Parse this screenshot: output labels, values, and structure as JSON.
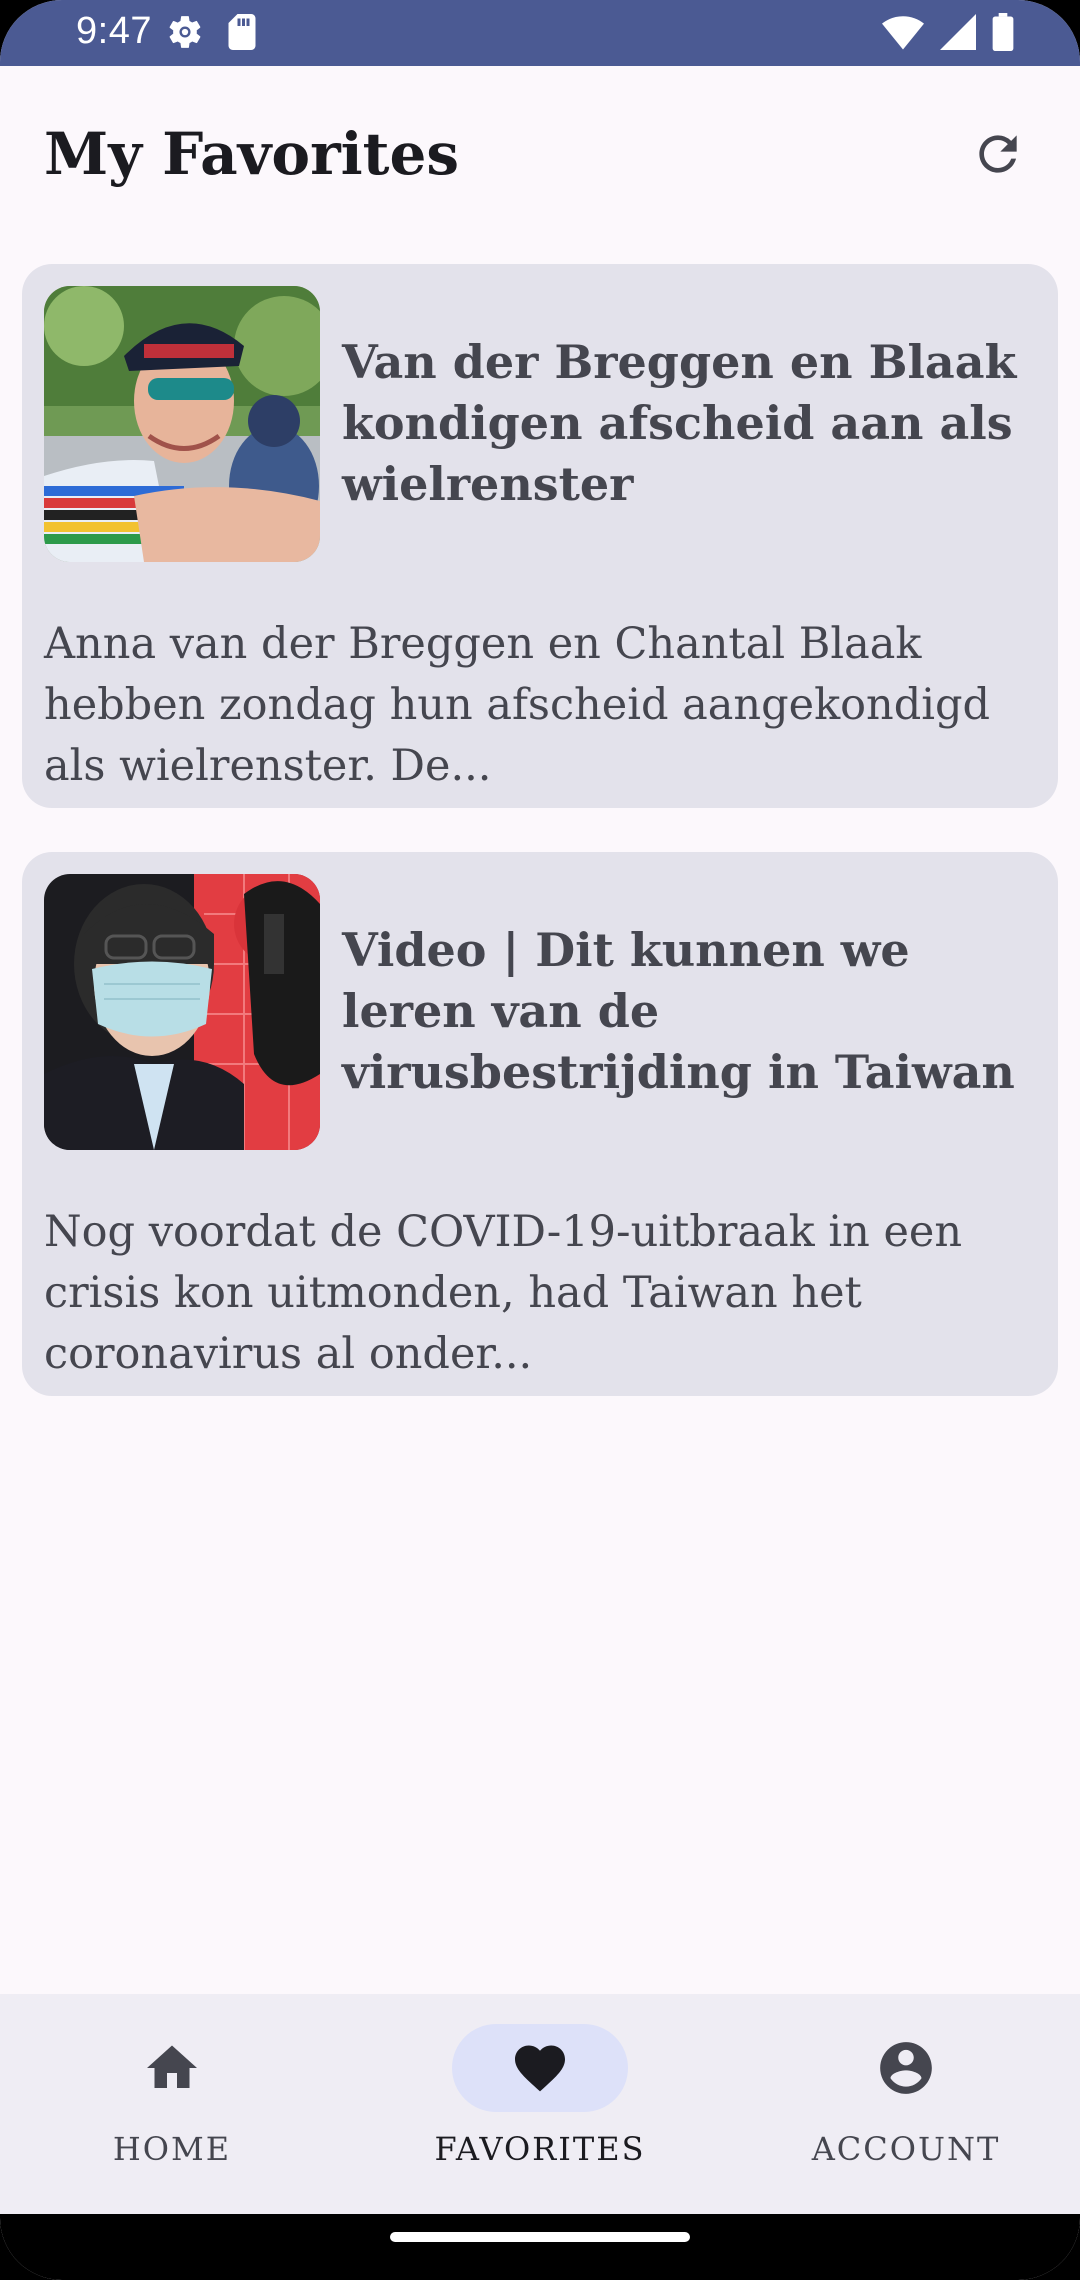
{
  "status_bar": {
    "time": "9:47",
    "left_icons": [
      "settings-gear-icon",
      "sd-card-icon"
    ],
    "right_icons": [
      "wifi-icon",
      "cellular-signal-icon",
      "battery-icon"
    ],
    "background": "#4b5a93"
  },
  "app_bar": {
    "title": "My Favorites",
    "action_icon": "refresh-icon"
  },
  "articles": [
    {
      "title": "Van der Breggen en Blaak kondigen afscheid aan als wielrenster",
      "excerpt": "Anna van der Breggen en Chantal Blaak hebben zondag hun afscheid aangekondigd als wielrenster. De...",
      "thumbnail": "cyclist-photo"
    },
    {
      "title": "Video | Dit kunnen we leren van de virusbestrijding in Taiwan",
      "excerpt": "Nog voordat de COVID-19-uitbraak in een crisis kon uitmonden, had Taiwan het coronavirus al onder...",
      "thumbnail": "masked-person-photo"
    }
  ],
  "bottom_nav": {
    "items": [
      {
        "label": "HOME",
        "icon": "home-icon",
        "active": false
      },
      {
        "label": "FAVORITES",
        "icon": "heart-icon",
        "active": true
      },
      {
        "label": "ACCOUNT",
        "icon": "account-circle-icon",
        "active": false
      }
    ]
  },
  "colors": {
    "background": "#fcf8fc",
    "card": "#e3e2eb",
    "nav_bar": "#efedf4",
    "active_pill": "#dde1f9",
    "text_primary": "#1b1b20",
    "text_secondary": "#45464f"
  }
}
